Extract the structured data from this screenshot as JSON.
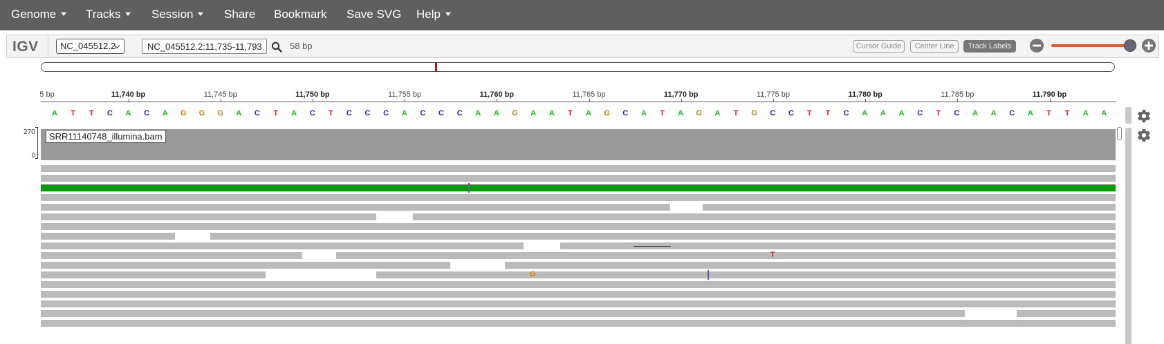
{
  "navbar": {
    "items": [
      {
        "label": "Genome",
        "dropdown": true
      },
      {
        "label": "Tracks",
        "dropdown": true
      },
      {
        "label": "Session",
        "dropdown": true
      },
      {
        "label": "Share",
        "dropdown": false
      },
      {
        "label": "Bookmark",
        "dropdown": false
      },
      {
        "label": "Save SVG",
        "dropdown": false
      },
      {
        "label": "Help",
        "dropdown": true
      }
    ]
  },
  "igv_bar": {
    "logo": "IGV",
    "chromosome": "NC_045512.2",
    "locus": "NC_045512.2:11,735-11,793",
    "locus_width": "58 bp",
    "toggles": {
      "cursor_guide": "Cursor Guide",
      "center_line": "Center Line",
      "track_labels": "Track Labels"
    },
    "track_labels_active": true
  },
  "ruler": {
    "first_label": "5 bp",
    "labels": [
      "11,740 bp",
      "11,745 bp",
      "11,750 bp",
      "11,755 bp",
      "11,760 bp",
      "11,765 bp",
      "11,770 bp",
      "11,775 bp",
      "11,780 bp",
      "11,785 bp",
      "11,790 bp"
    ],
    "bold_labels": [
      "11,740 bp",
      "11,750 bp",
      "11,760 bp",
      "11,770 bp",
      "11,780 bp",
      "11,790 bp"
    ]
  },
  "sequence": "ATTCACAGGGACTACTCCCACCCAAGAATAGCATAGATGCCTTCAAACTCAACATTAA",
  "base_colors": {
    "A": "#22bb22",
    "T": "#e02020",
    "C": "#2020dd",
    "G": "#d07a00"
  },
  "coverage": {
    "range_max": "270",
    "range_min": "0"
  },
  "alignment_track": {
    "label": "SRR11140748_illumina.bam",
    "read_color": "#bbbbbb",
    "highlight_color": "#0a9b0a",
    "mismatches": [
      {
        "row": 9,
        "base": "T",
        "color": "#e02020"
      },
      {
        "row": 11,
        "base": "G",
        "color": "#d07a00"
      }
    ]
  },
  "icons": [
    "search-icon",
    "zoom-out-icon",
    "zoom-in-icon",
    "gear-icon"
  ]
}
